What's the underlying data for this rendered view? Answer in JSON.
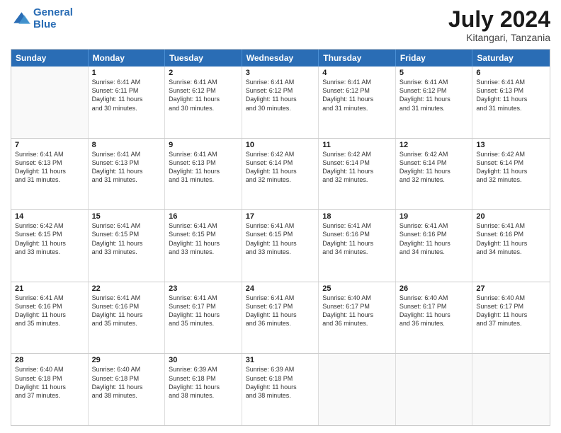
{
  "logo": {
    "line1": "General",
    "line2": "Blue"
  },
  "header": {
    "month": "July 2024",
    "location": "Kitangari, Tanzania"
  },
  "weekdays": [
    "Sunday",
    "Monday",
    "Tuesday",
    "Wednesday",
    "Thursday",
    "Friday",
    "Saturday"
  ],
  "rows": [
    [
      {
        "day": "",
        "lines": []
      },
      {
        "day": "1",
        "lines": [
          "Sunrise: 6:41 AM",
          "Sunset: 6:11 PM",
          "Daylight: 11 hours",
          "and 30 minutes."
        ]
      },
      {
        "day": "2",
        "lines": [
          "Sunrise: 6:41 AM",
          "Sunset: 6:12 PM",
          "Daylight: 11 hours",
          "and 30 minutes."
        ]
      },
      {
        "day": "3",
        "lines": [
          "Sunrise: 6:41 AM",
          "Sunset: 6:12 PM",
          "Daylight: 11 hours",
          "and 30 minutes."
        ]
      },
      {
        "day": "4",
        "lines": [
          "Sunrise: 6:41 AM",
          "Sunset: 6:12 PM",
          "Daylight: 11 hours",
          "and 31 minutes."
        ]
      },
      {
        "day": "5",
        "lines": [
          "Sunrise: 6:41 AM",
          "Sunset: 6:12 PM",
          "Daylight: 11 hours",
          "and 31 minutes."
        ]
      },
      {
        "day": "6",
        "lines": [
          "Sunrise: 6:41 AM",
          "Sunset: 6:13 PM",
          "Daylight: 11 hours",
          "and 31 minutes."
        ]
      }
    ],
    [
      {
        "day": "7",
        "lines": [
          "Sunrise: 6:41 AM",
          "Sunset: 6:13 PM",
          "Daylight: 11 hours",
          "and 31 minutes."
        ]
      },
      {
        "day": "8",
        "lines": [
          "Sunrise: 6:41 AM",
          "Sunset: 6:13 PM",
          "Daylight: 11 hours",
          "and 31 minutes."
        ]
      },
      {
        "day": "9",
        "lines": [
          "Sunrise: 6:41 AM",
          "Sunset: 6:13 PM",
          "Daylight: 11 hours",
          "and 31 minutes."
        ]
      },
      {
        "day": "10",
        "lines": [
          "Sunrise: 6:42 AM",
          "Sunset: 6:14 PM",
          "Daylight: 11 hours",
          "and 32 minutes."
        ]
      },
      {
        "day": "11",
        "lines": [
          "Sunrise: 6:42 AM",
          "Sunset: 6:14 PM",
          "Daylight: 11 hours",
          "and 32 minutes."
        ]
      },
      {
        "day": "12",
        "lines": [
          "Sunrise: 6:42 AM",
          "Sunset: 6:14 PM",
          "Daylight: 11 hours",
          "and 32 minutes."
        ]
      },
      {
        "day": "13",
        "lines": [
          "Sunrise: 6:42 AM",
          "Sunset: 6:14 PM",
          "Daylight: 11 hours",
          "and 32 minutes."
        ]
      }
    ],
    [
      {
        "day": "14",
        "lines": [
          "Sunrise: 6:42 AM",
          "Sunset: 6:15 PM",
          "Daylight: 11 hours",
          "and 33 minutes."
        ]
      },
      {
        "day": "15",
        "lines": [
          "Sunrise: 6:41 AM",
          "Sunset: 6:15 PM",
          "Daylight: 11 hours",
          "and 33 minutes."
        ]
      },
      {
        "day": "16",
        "lines": [
          "Sunrise: 6:41 AM",
          "Sunset: 6:15 PM",
          "Daylight: 11 hours",
          "and 33 minutes."
        ]
      },
      {
        "day": "17",
        "lines": [
          "Sunrise: 6:41 AM",
          "Sunset: 6:15 PM",
          "Daylight: 11 hours",
          "and 33 minutes."
        ]
      },
      {
        "day": "18",
        "lines": [
          "Sunrise: 6:41 AM",
          "Sunset: 6:16 PM",
          "Daylight: 11 hours",
          "and 34 minutes."
        ]
      },
      {
        "day": "19",
        "lines": [
          "Sunrise: 6:41 AM",
          "Sunset: 6:16 PM",
          "Daylight: 11 hours",
          "and 34 minutes."
        ]
      },
      {
        "day": "20",
        "lines": [
          "Sunrise: 6:41 AM",
          "Sunset: 6:16 PM",
          "Daylight: 11 hours",
          "and 34 minutes."
        ]
      }
    ],
    [
      {
        "day": "21",
        "lines": [
          "Sunrise: 6:41 AM",
          "Sunset: 6:16 PM",
          "Daylight: 11 hours",
          "and 35 minutes."
        ]
      },
      {
        "day": "22",
        "lines": [
          "Sunrise: 6:41 AM",
          "Sunset: 6:16 PM",
          "Daylight: 11 hours",
          "and 35 minutes."
        ]
      },
      {
        "day": "23",
        "lines": [
          "Sunrise: 6:41 AM",
          "Sunset: 6:17 PM",
          "Daylight: 11 hours",
          "and 35 minutes."
        ]
      },
      {
        "day": "24",
        "lines": [
          "Sunrise: 6:41 AM",
          "Sunset: 6:17 PM",
          "Daylight: 11 hours",
          "and 36 minutes."
        ]
      },
      {
        "day": "25",
        "lines": [
          "Sunrise: 6:40 AM",
          "Sunset: 6:17 PM",
          "Daylight: 11 hours",
          "and 36 minutes."
        ]
      },
      {
        "day": "26",
        "lines": [
          "Sunrise: 6:40 AM",
          "Sunset: 6:17 PM",
          "Daylight: 11 hours",
          "and 36 minutes."
        ]
      },
      {
        "day": "27",
        "lines": [
          "Sunrise: 6:40 AM",
          "Sunset: 6:17 PM",
          "Daylight: 11 hours",
          "and 37 minutes."
        ]
      }
    ],
    [
      {
        "day": "28",
        "lines": [
          "Sunrise: 6:40 AM",
          "Sunset: 6:18 PM",
          "Daylight: 11 hours",
          "and 37 minutes."
        ]
      },
      {
        "day": "29",
        "lines": [
          "Sunrise: 6:40 AM",
          "Sunset: 6:18 PM",
          "Daylight: 11 hours",
          "and 38 minutes."
        ]
      },
      {
        "day": "30",
        "lines": [
          "Sunrise: 6:39 AM",
          "Sunset: 6:18 PM",
          "Daylight: 11 hours",
          "and 38 minutes."
        ]
      },
      {
        "day": "31",
        "lines": [
          "Sunrise: 6:39 AM",
          "Sunset: 6:18 PM",
          "Daylight: 11 hours",
          "and 38 minutes."
        ]
      },
      {
        "day": "",
        "lines": []
      },
      {
        "day": "",
        "lines": []
      },
      {
        "day": "",
        "lines": []
      }
    ]
  ]
}
